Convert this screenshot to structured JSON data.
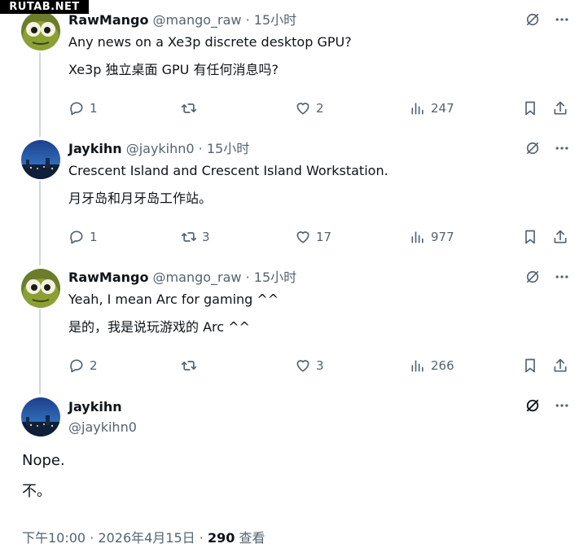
{
  "watermark": "RUTAB.NET",
  "replies": [
    {
      "name": "RawMango",
      "handle": "@mango_raw",
      "separator": "·",
      "time": "15小时",
      "text_en": "Any news on a Xe3p discrete desktop GPU?",
      "text_zh": "Xe3p 独立桌面 GPU 有任何消息吗?",
      "replies": "1",
      "reposts": "",
      "likes": "2",
      "views": "247"
    },
    {
      "name": "Jaykihn",
      "handle": "@jaykihn0",
      "separator": "·",
      "time": "15小时",
      "text_en": "Crescent Island and Crescent Island Workstation.",
      "text_zh": "月牙岛和月牙岛工作站。",
      "replies": "1",
      "reposts": "3",
      "likes": "17",
      "views": "977"
    },
    {
      "name": "RawMango",
      "handle": "@mango_raw",
      "separator": "·",
      "time": "15小时",
      "text_en": "Yeah, I mean Arc for gaming ^^",
      "text_zh": "是的，我是说玩游戏的 Arc ^^",
      "replies": "2",
      "reposts": "",
      "likes": "3",
      "views": "266"
    }
  ],
  "main": {
    "name": "Jaykihn",
    "handle": "@jaykihn0",
    "text_en": "Nope.",
    "text_zh": "不。",
    "time": "下午10:00",
    "separator": "·",
    "date": "2026年4月15日",
    "separator2": "·",
    "views": "290",
    "views_label": "查看"
  },
  "icons": {
    "grok": "grok-icon",
    "more": "more-icon",
    "reply": "reply-icon",
    "repost": "repost-icon",
    "like": "like-icon",
    "views": "views-icon",
    "bookmark": "bookmark-icon",
    "share": "share-icon"
  },
  "colors": {
    "text": "#0f1419",
    "secondary": "#536471",
    "thread_line": "#cfd9de"
  }
}
